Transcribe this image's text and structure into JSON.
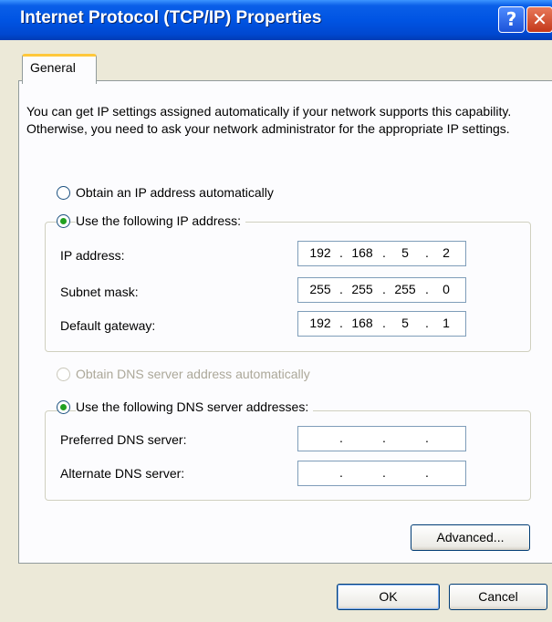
{
  "window": {
    "title": "Internet Protocol (TCP/IP) Properties"
  },
  "titlebar_buttons": {
    "help": "?",
    "close": "✕"
  },
  "tabs": [
    {
      "label": "General"
    }
  ],
  "intro_text": "You can get IP settings assigned automatically if your network supports this capability. Otherwise, you need to ask your network administrator for the appropriate IP settings.",
  "ip_mode": {
    "auto_label": "Obtain an IP address automatically",
    "manual_label": "Use the following IP address:",
    "selected": "manual"
  },
  "ip_fields": [
    {
      "label": "IP address:",
      "octets": [
        "192",
        "168",
        "5",
        "2"
      ]
    },
    {
      "label": "Subnet mask:",
      "octets": [
        "255",
        "255",
        "255",
        "0"
      ]
    },
    {
      "label": "Default gateway:",
      "octets": [
        "192",
        "168",
        "5",
        "1"
      ]
    }
  ],
  "dns_mode": {
    "auto_label": "Obtain DNS server address automatically",
    "manual_label": "Use the following DNS server addresses:",
    "selected": "manual",
    "auto_disabled": true
  },
  "dns_fields": [
    {
      "label": "Preferred DNS server:",
      "octets": [
        "",
        "",
        "",
        ""
      ]
    },
    {
      "label": "Alternate DNS server:",
      "octets": [
        "",
        "",
        "",
        ""
      ]
    }
  ],
  "buttons": {
    "advanced": "Advanced...",
    "ok": "OK",
    "cancel": "Cancel"
  },
  "colors": {
    "titlebar": "#0054e3",
    "dialog_bg": "#ece9d8",
    "radio_dot": "#21a121",
    "tab_highlight": "#ffc83c"
  }
}
